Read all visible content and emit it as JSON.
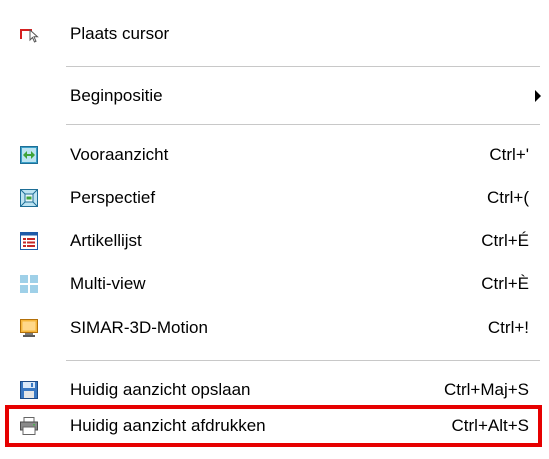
{
  "menu": {
    "items": [
      {
        "label": "Plaats cursor",
        "shortcut": "",
        "icon": "place-cursor-icon"
      },
      {
        "label": "Beginpositie",
        "shortcut": "",
        "icon": "",
        "submenu": true
      },
      {
        "label": "Vooraanzicht",
        "shortcut": "Ctrl+'",
        "icon": "front-view-icon"
      },
      {
        "label": "Perspectief",
        "shortcut": "Ctrl+(",
        "icon": "perspective-icon"
      },
      {
        "label": "Artikellijst",
        "shortcut": "Ctrl+É",
        "icon": "article-list-icon"
      },
      {
        "label": "Multi-view",
        "shortcut": "Ctrl+È",
        "icon": "multi-view-icon"
      },
      {
        "label": "SIMAR-3D-Motion",
        "shortcut": "Ctrl+!",
        "icon": "3d-motion-icon"
      },
      {
        "label": "Huidig aanzicht opslaan",
        "shortcut": "Ctrl+Maj+S",
        "icon": "save-view-icon"
      },
      {
        "label": "Huidig aanzicht afdrukken",
        "shortcut": "Ctrl+Alt+S",
        "icon": "print-view-icon"
      }
    ]
  },
  "colors": {
    "highlight_border": "#e60000",
    "separator": "#c8c8c8"
  }
}
